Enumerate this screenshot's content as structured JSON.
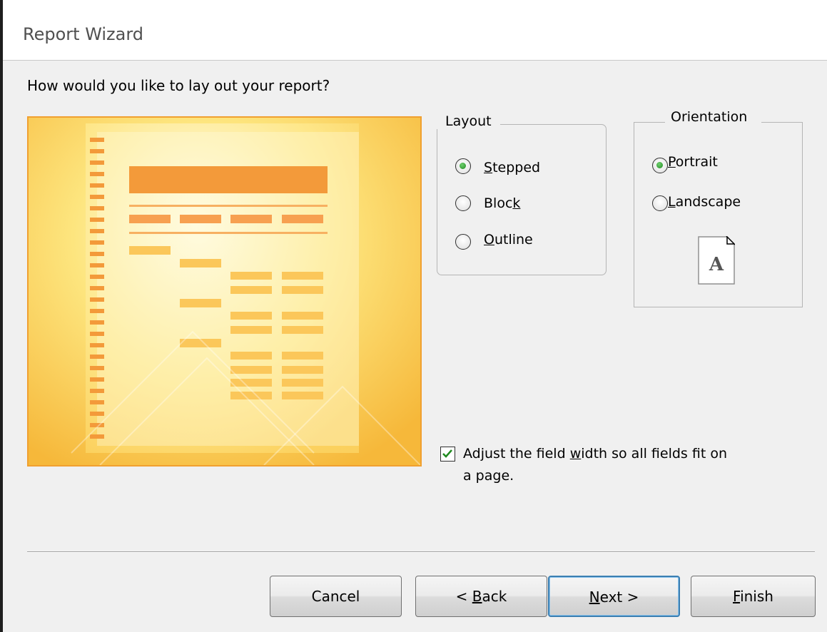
{
  "window": {
    "title": "Report Wizard"
  },
  "prompt": "How would you like to lay out your report?",
  "layout": {
    "legend": "Layout",
    "options": [
      {
        "pre": "",
        "accel": "S",
        "post": "tepped",
        "checked": true
      },
      {
        "pre": "Bloc",
        "accel": "k",
        "post": "",
        "checked": false
      },
      {
        "pre": "",
        "accel": "O",
        "post": "utline",
        "checked": false
      }
    ]
  },
  "orientation": {
    "legend": "Orientation",
    "options": [
      {
        "pre": "",
        "accel": "P",
        "post": "ortrait",
        "checked": true
      },
      {
        "pre": "",
        "accel": "L",
        "post": "andscape",
        "checked": false
      }
    ],
    "page_letter": "A"
  },
  "adjust_width": {
    "checked": true,
    "line1_pre": "Adjust the field ",
    "line1_accel": "w",
    "line1_post": "idth so all fields fit on",
    "line2": "a page."
  },
  "buttons": {
    "cancel": "Cancel",
    "back_pre": "< ",
    "back_accel": "B",
    "back_post": "ack",
    "next_accel": "N",
    "next_post": "ext >",
    "finish_accel": "F",
    "finish_post": "inish"
  },
  "colors": {
    "preview_orange": "#f7b733",
    "preview_header_bar": "#f39a3a",
    "radio_dot": "#2f9e2f",
    "checkmark": "#1f8a1f",
    "default_button_border": "#3c7fb1"
  }
}
